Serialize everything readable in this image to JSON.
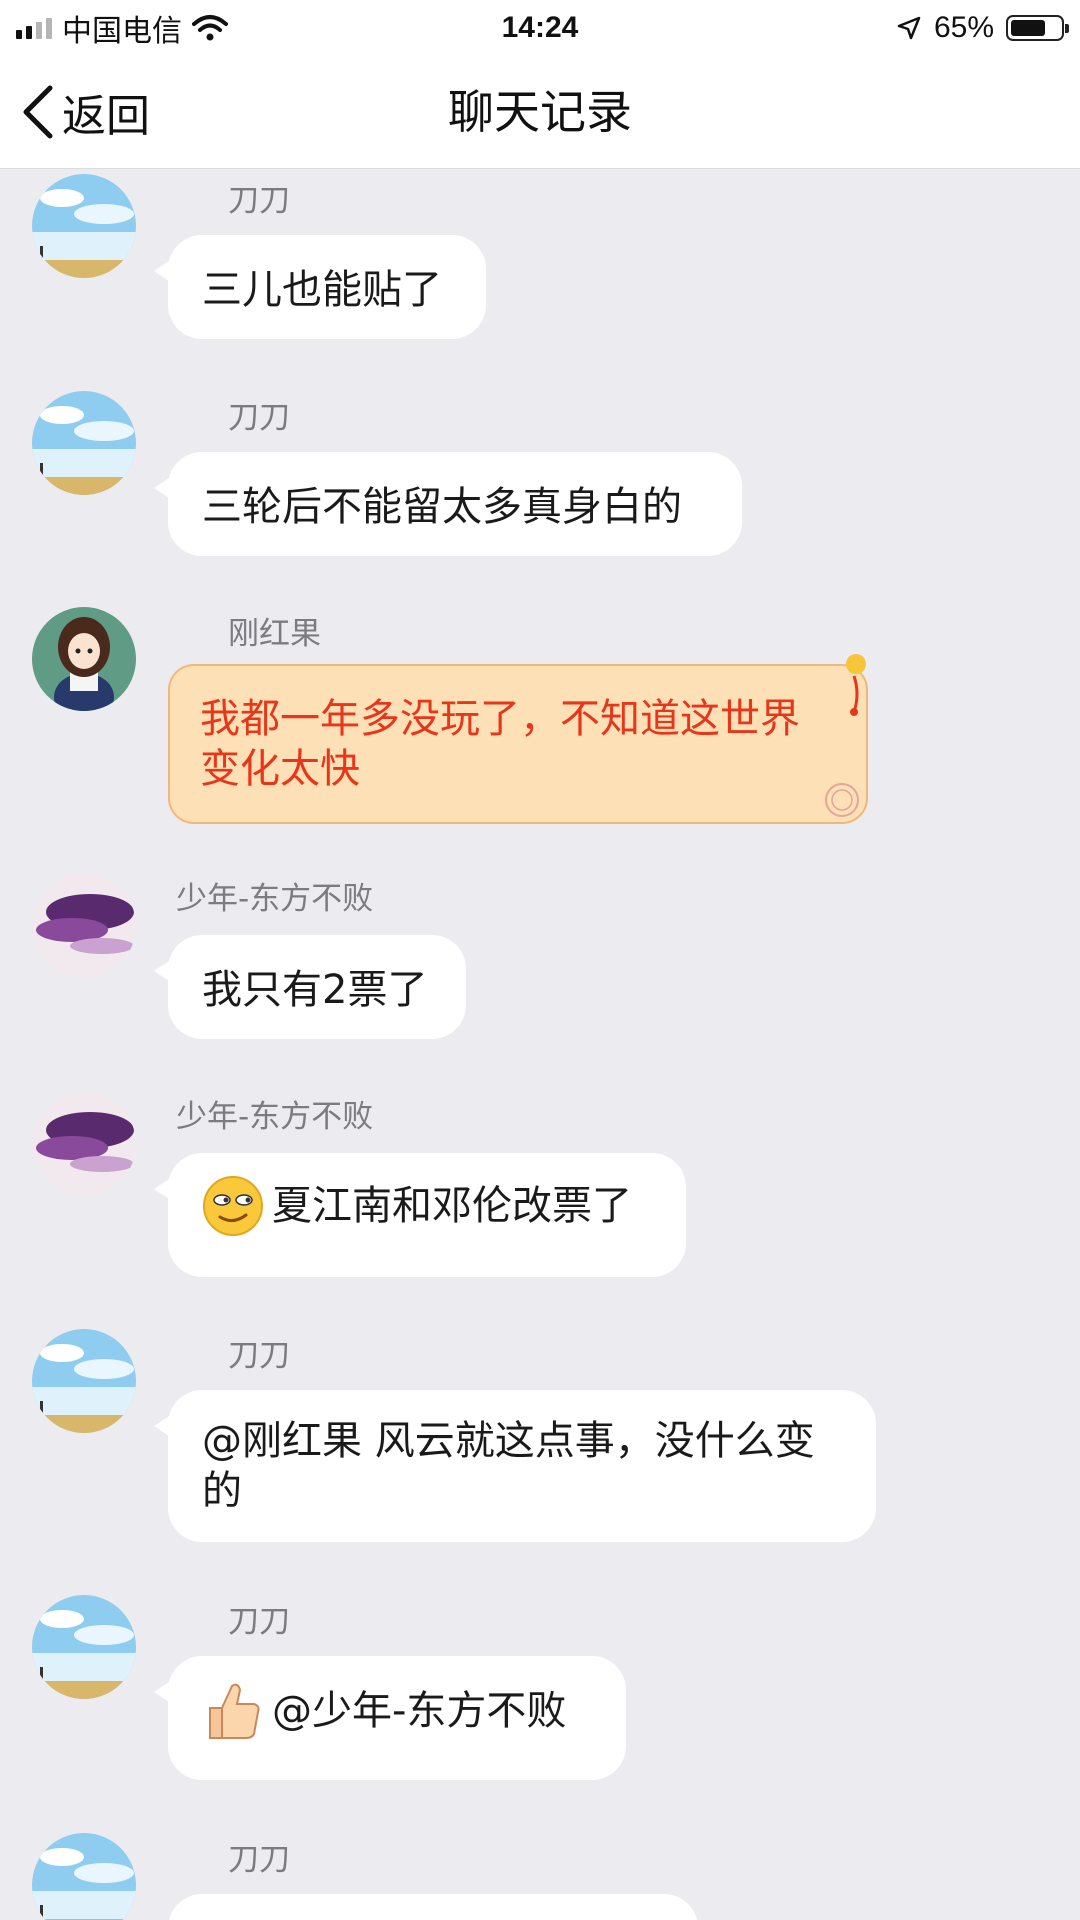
{
  "status_bar": {
    "carrier": "中国电信",
    "time": "14:24",
    "battery_percent": "65%"
  },
  "nav": {
    "back_label": "返回",
    "title": "聊天记录"
  },
  "messages": [
    {
      "sender": "刀刀",
      "text": "三儿也能贴了"
    },
    {
      "sender": "刀刀",
      "text": "三轮后不能留太多真身白的"
    },
    {
      "sender": "刚红果",
      "text": "我都一年多没玩了，不知道这世界变化太快"
    },
    {
      "sender": "少年-东方不败",
      "text": "我只有2票了"
    },
    {
      "sender": "少年-东方不败",
      "text": "夏江南和邓伦改票了",
      "emoji": "smirk-face-emoji"
    },
    {
      "sender": "刀刀",
      "text": "@刚红果 风云就这点事，没什么变的"
    },
    {
      "sender": "刀刀",
      "text": "@少年-东方不败",
      "emoji": "thumbs-up-emoji"
    },
    {
      "sender": "刀刀",
      "text": ""
    }
  ]
}
